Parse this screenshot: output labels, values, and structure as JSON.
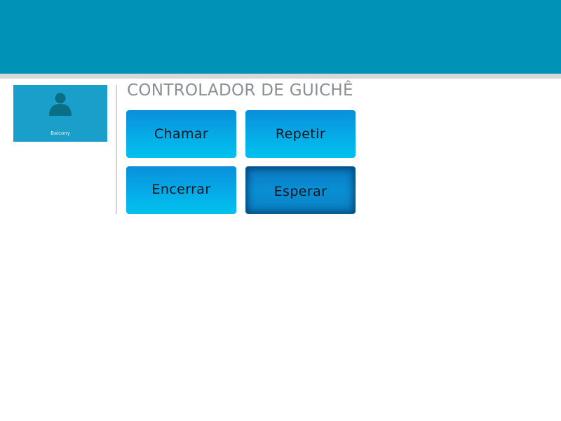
{
  "header": {
    "color": "#0093b8"
  },
  "user": {
    "name": "Balcony",
    "icon": "person-icon"
  },
  "controller": {
    "title": "CONTROLADOR DE GUICHÊ",
    "buttons": {
      "call": "Chamar",
      "repeat": "Repetir",
      "close": "Encerrar",
      "wait": "Esperar"
    },
    "pressed_button": "Esperar",
    "accent_color": "#05aee8"
  }
}
